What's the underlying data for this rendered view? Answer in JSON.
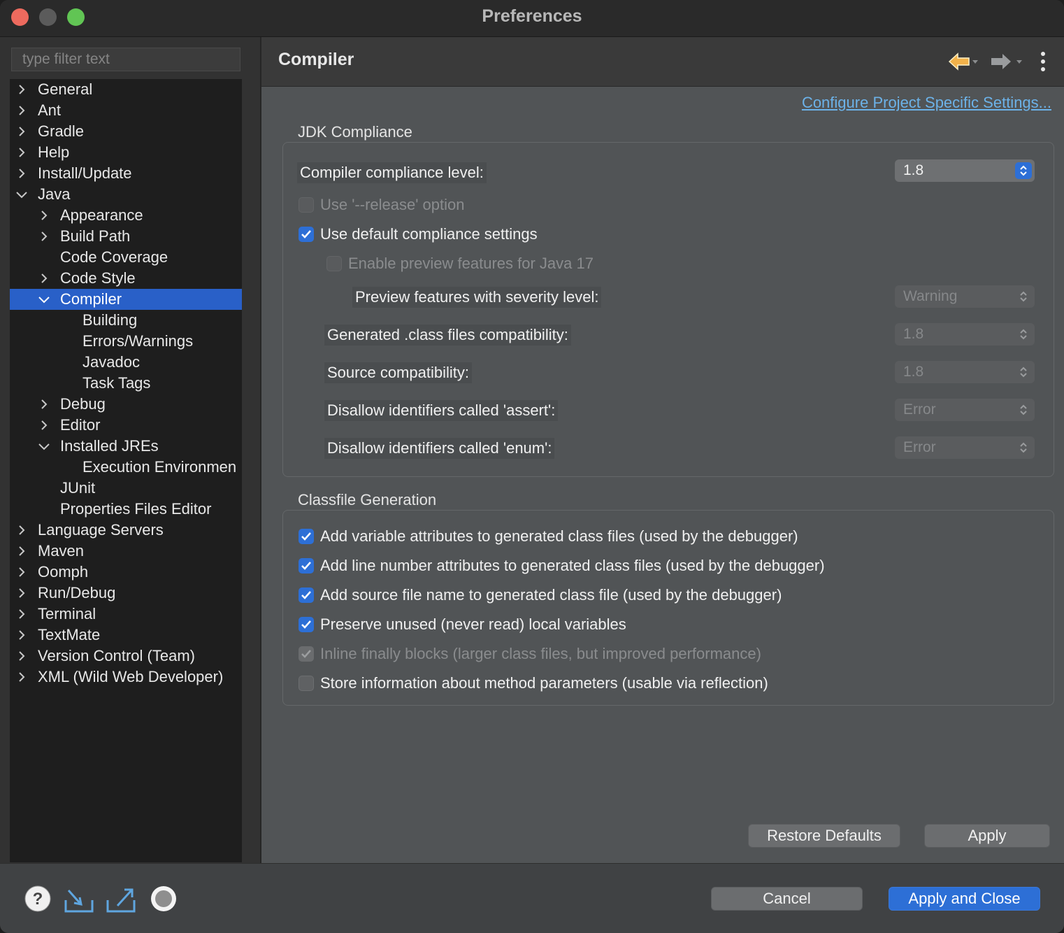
{
  "window": {
    "title": "Preferences"
  },
  "sidebar": {
    "filter_placeholder": "type filter text",
    "items": [
      {
        "label": "General",
        "level": 0,
        "chevron": "right"
      },
      {
        "label": "Ant",
        "level": 0,
        "chevron": "right"
      },
      {
        "label": "Gradle",
        "level": 0,
        "chevron": "right"
      },
      {
        "label": "Help",
        "level": 0,
        "chevron": "right"
      },
      {
        "label": "Install/Update",
        "level": 0,
        "chevron": "right"
      },
      {
        "label": "Java",
        "level": 0,
        "chevron": "down"
      },
      {
        "label": "Appearance",
        "level": 1,
        "chevron": "right"
      },
      {
        "label": "Build Path",
        "level": 1,
        "chevron": "right"
      },
      {
        "label": "Code Coverage",
        "level": 1,
        "chevron": "none"
      },
      {
        "label": "Code Style",
        "level": 1,
        "chevron": "right"
      },
      {
        "label": "Compiler",
        "level": 1,
        "chevron": "down",
        "selected": true
      },
      {
        "label": "Building",
        "level": 2,
        "chevron": "none"
      },
      {
        "label": "Errors/Warnings",
        "level": 2,
        "chevron": "none"
      },
      {
        "label": "Javadoc",
        "level": 2,
        "chevron": "none"
      },
      {
        "label": "Task Tags",
        "level": 2,
        "chevron": "none"
      },
      {
        "label": "Debug",
        "level": 1,
        "chevron": "right"
      },
      {
        "label": "Editor",
        "level": 1,
        "chevron": "right"
      },
      {
        "label": "Installed JREs",
        "level": 1,
        "chevron": "down"
      },
      {
        "label": "Execution Environmen",
        "level": 2,
        "chevron": "none"
      },
      {
        "label": "JUnit",
        "level": 1,
        "chevron": "none"
      },
      {
        "label": "Properties Files Editor",
        "level": 1,
        "chevron": "none"
      },
      {
        "label": "Language Servers",
        "level": 0,
        "chevron": "right"
      },
      {
        "label": "Maven",
        "level": 0,
        "chevron": "right"
      },
      {
        "label": "Oomph",
        "level": 0,
        "chevron": "right"
      },
      {
        "label": "Run/Debug",
        "level": 0,
        "chevron": "right"
      },
      {
        "label": "Terminal",
        "level": 0,
        "chevron": "right"
      },
      {
        "label": "TextMate",
        "level": 0,
        "chevron": "right"
      },
      {
        "label": "Version Control (Team)",
        "level": 0,
        "chevron": "right"
      },
      {
        "label": "XML (Wild Web Developer)",
        "level": 0,
        "chevron": "right"
      }
    ]
  },
  "page": {
    "title": "Compiler",
    "header_icons": [
      "back-arrow-icon",
      "forward-arrow-icon",
      "more-vertical-icon"
    ],
    "configure_link": "Configure Project Specific Settings...",
    "jdk": {
      "group_title": "JDK Compliance",
      "compliance_label": "Compiler compliance level:",
      "compliance_value": "1.8",
      "release_option": {
        "label": "Use '--release' option",
        "checked": false,
        "enabled": false
      },
      "default_compliance": {
        "label": "Use default compliance settings",
        "checked": true,
        "enabled": true
      },
      "preview_features": {
        "label": "Enable preview features for Java 17",
        "checked": false,
        "enabled": false
      },
      "preview_severity_label": "Preview features with severity level:",
      "preview_severity_value": "Warning",
      "class_compat_label": "Generated .class files compatibility:",
      "class_compat_value": "1.8",
      "source_compat_label": "Source compatibility:",
      "source_compat_value": "1.8",
      "assert_label": "Disallow identifiers called 'assert':",
      "assert_value": "Error",
      "enum_label": "Disallow identifiers called 'enum':",
      "enum_value": "Error"
    },
    "classfile": {
      "group_title": "Classfile Generation",
      "options": [
        {
          "label": "Add variable attributes to generated class files (used by the debugger)",
          "checked": true,
          "enabled": true
        },
        {
          "label": "Add line number attributes to generated class files (used by the debugger)",
          "checked": true,
          "enabled": true
        },
        {
          "label": "Add source file name to generated class file (used by the debugger)",
          "checked": true,
          "enabled": true
        },
        {
          "label": "Preserve unused (never read) local variables",
          "checked": true,
          "enabled": true
        },
        {
          "label": "Inline finally blocks (larger class files, but improved performance)",
          "checked": true,
          "enabled": false
        },
        {
          "label": "Store information about method parameters (usable via reflection)",
          "checked": false,
          "enabled": true
        }
      ]
    },
    "restore_defaults": "Restore Defaults",
    "apply": "Apply"
  },
  "footer": {
    "icons": [
      "help-icon",
      "import-icon",
      "export-icon",
      "record-icon"
    ],
    "cancel": "Cancel",
    "apply_close": "Apply and Close"
  },
  "colors": {
    "accent": "#2d6fd6",
    "selection": "#2960c8",
    "link": "#6cb2e8"
  }
}
